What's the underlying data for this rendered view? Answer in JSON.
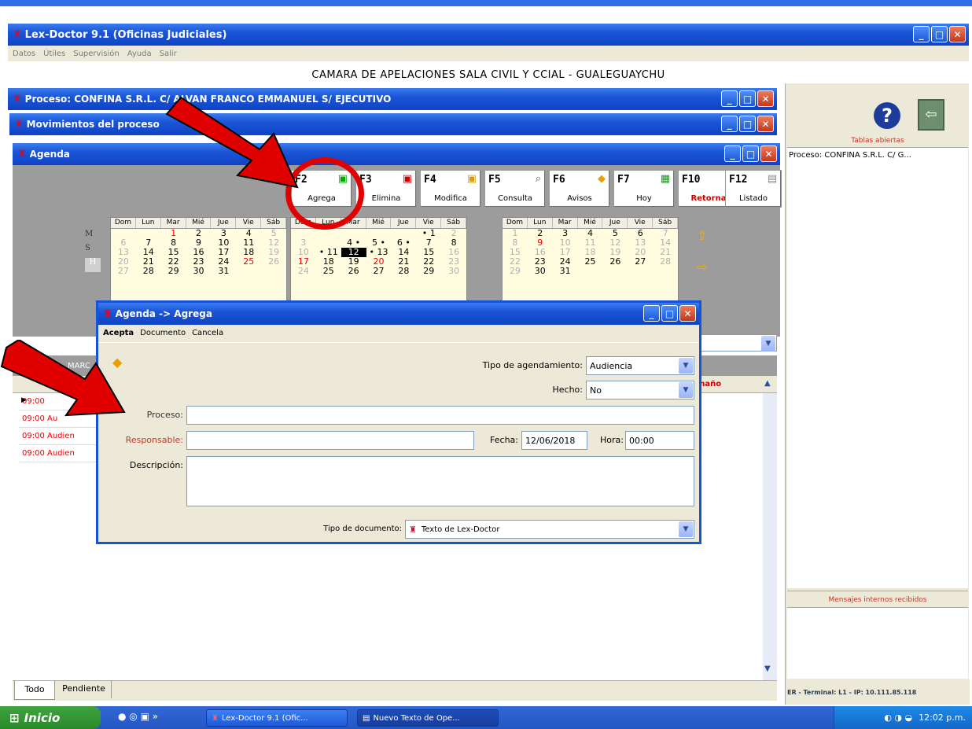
{
  "main_window": {
    "title": "Lex-Doctor 9.1 (Oficinas Judiciales)",
    "menu": [
      "Datos",
      "Útiles",
      "Supervisión",
      "Ayuda",
      "Salir"
    ],
    "court_header": "CAMARA DE APELACIONES SALA CIVIL Y CCIAL - GUALEGUAYCHU"
  },
  "windows": {
    "proceso_title": "Proceso: CONFINA S.R.L. C/ ALVAN FRANCO EMMANUEL S/ EJECUTIVO",
    "movimientos_title": "Movimientos del proceso",
    "agenda_title": "Agenda"
  },
  "toolbar": {
    "buttons": [
      {
        "key": "F2",
        "label": "Agrega"
      },
      {
        "key": "F3",
        "label": "Elimina"
      },
      {
        "key": "F4",
        "label": "Modifica"
      },
      {
        "key": "F5",
        "label": "Consulta"
      },
      {
        "key": "F6",
        "label": "Avisos"
      },
      {
        "key": "F7",
        "label": "Hoy"
      },
      {
        "key": "F10",
        "label": "Retorna"
      },
      {
        "key": "F12",
        "label": "Listado"
      }
    ]
  },
  "calendars": {
    "day_headers": [
      "Dom",
      "Lun",
      "Mar",
      "Mié",
      "Jue",
      "Vie",
      "Sáb"
    ],
    "side_letters": [
      "M",
      "S",
      "H"
    ]
  },
  "agenda_list": {
    "header": "MARC",
    "col_tamano": "maño",
    "rows": [
      "09:00",
      "09:00  Au",
      "09:00  Audien",
      "09:00  Audien"
    ]
  },
  "tabs": {
    "todo": "Todo",
    "pendiente": "Pendiente"
  },
  "right_panel": {
    "tablas_header": "Tablas abiertas",
    "tablas_item": "Proceso: CONFINA S.R.L. C/ G...",
    "mensajes_header": "Mensajes internos recibidos",
    "status": "ER - Terminal: L1 - IP: 10.111.85.118"
  },
  "dialog": {
    "title": "Agenda -> Agrega",
    "menu": {
      "acepta": "Acepta",
      "documento": "Documento",
      "cancela": "Cancela"
    },
    "tipo_label": "Tipo de agendamiento:",
    "tipo_value": "Audiencia",
    "hecho_label": "Hecho:",
    "hecho_value": "No",
    "proceso_label": "Proceso:",
    "proceso_value": "",
    "responsable_label": "Responsable:",
    "responsable_value": "",
    "fecha_label": "Fecha:",
    "fecha_value": "12/06/2018",
    "hora_label": "Hora:",
    "hora_value": "00:00",
    "descripcion_label": "Descripción:",
    "descripcion_value": "",
    "tipo_doc_label": "Tipo de documento:",
    "tipo_doc_value": "Texto de Lex-Doctor"
  },
  "taskbar": {
    "start": "Inicio",
    "item1": "Lex-Doctor 9.1 (Ofic...",
    "item2": "Nuevo Texto de Ope...",
    "clock": "12:02 p.m."
  },
  "colors": {
    "xp_blue": "#1a55d6",
    "annotation_red": "#e00000",
    "calendar_bg": "#fffce0"
  }
}
